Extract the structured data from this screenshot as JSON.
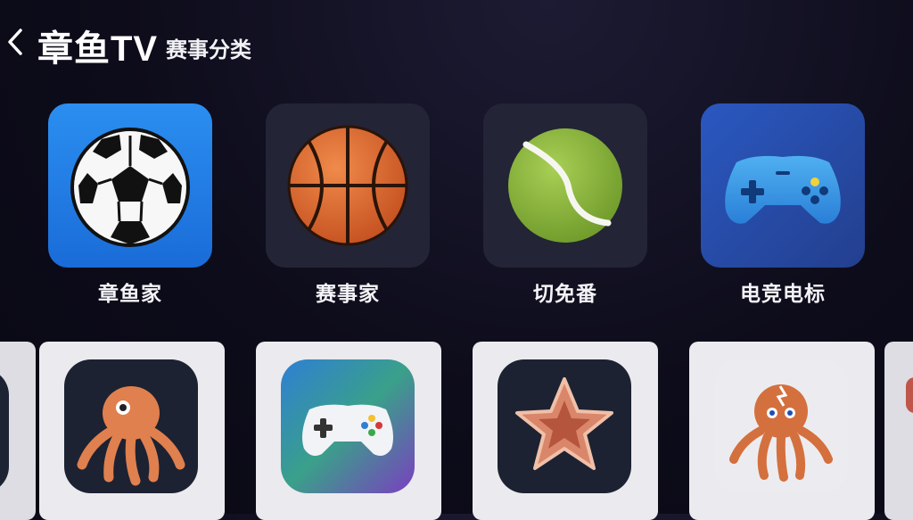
{
  "header": {
    "back_icon": "chevron-left-icon",
    "title": "章鱼TV",
    "subtitle": "赛事分类"
  },
  "categories": [
    {
      "label": "章鱼家",
      "icon": "soccer-ball-icon",
      "tile_color": "#1f7fe6"
    },
    {
      "label": "赛事家",
      "icon": "basketball-icon",
      "tile_color": "#232436"
    },
    {
      "label": "切免番",
      "icon": "tennis-ball-icon",
      "tile_color": "#232436"
    },
    {
      "label": "电竞电标",
      "icon": "gamepad-icon",
      "tile_color": "#2a4fb0"
    }
  ],
  "apps": [
    {
      "icon": "octopus-icon"
    },
    {
      "icon": "game-controller-icon"
    },
    {
      "icon": "star-icon"
    },
    {
      "icon": "octopus-mascot-icon"
    }
  ]
}
